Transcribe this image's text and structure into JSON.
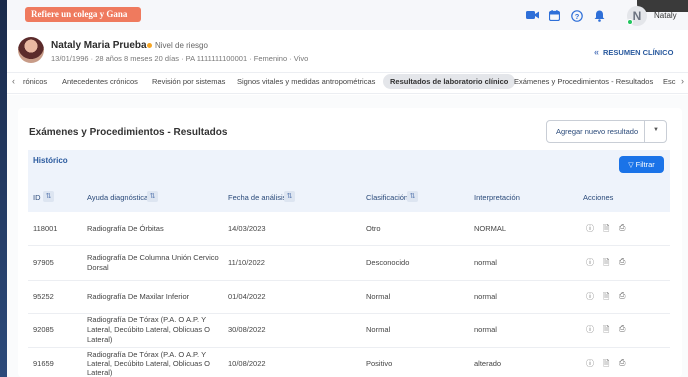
{
  "topbar": {
    "refer_label": "Refiere un colega y Gana",
    "icons": [
      "video-icon",
      "calendar-icon",
      "help-icon",
      "bell-icon"
    ],
    "user_initial": "N",
    "user_name": "Nataly"
  },
  "patient": {
    "name": "Nataly Maria Prueba",
    "risk_label": "Nivel de riesgo",
    "meta": "13/01/1996 · 28 años 8 meses 20 días · PA 1111111100001 · Femenino · Vivo",
    "summary_label": "RESUMEN CLÍNICO"
  },
  "tabs": [
    "rónicos",
    "Antecedentes crónicos",
    "Revisión por sistemas",
    "Signos vitales y medidas antropométricas",
    "Resultados de laboratorio clínico",
    "Exámenes y Procedimientos - Resultados",
    "Esc"
  ],
  "active_tab": "Resultados de laboratorio clínico",
  "main": {
    "title": "Exámenes y Procedimientos - Resultados",
    "add_button": "Agregar nuevo resultado",
    "history_title": "Histórico",
    "filter_label": "Filtrar"
  },
  "table": {
    "headers": [
      "ID",
      "Ayuda diagnóstica",
      "Fecha de análisis",
      "Clasificación",
      "Interpretación",
      "Acciones"
    ],
    "rows": [
      {
        "id": "118001",
        "ayuda": [
          "Radiografía De Órbitas"
        ],
        "fecha": "14/03/2023",
        "clasificacion": "Otro",
        "interpretacion": "NORMAL"
      },
      {
        "id": "97905",
        "ayuda": [
          "Radiografía De Columna Unión Cervico",
          "Dorsal"
        ],
        "fecha": "11/10/2022",
        "clasificacion": "Desconocido",
        "interpretacion": "normal"
      },
      {
        "id": "95252",
        "ayuda": [
          "Radiografía De Maxilar Inferior"
        ],
        "fecha": "01/04/2022",
        "clasificacion": "Normal",
        "interpretacion": "normal"
      },
      {
        "id": "92085",
        "ayuda": [
          "Radiografía De Tórax (P.A. O A.P. Y",
          "Lateral, Decúbito Lateral, Oblicuas O",
          "Lateral)"
        ],
        "fecha": "30/08/2022",
        "clasificacion": "Normal",
        "interpretacion": "normal"
      },
      {
        "id": "91659",
        "ayuda": [
          "Radiografía De Tórax (P.A. O A.P. Y",
          "Lateral, Decúbito Lateral, Oblicuas O",
          "Lateral)"
        ],
        "fecha": "10/08/2022",
        "clasificacion": "Positivo",
        "interpretacion": "alterado"
      }
    ],
    "row_actions": [
      "info-icon",
      "document-icon",
      "print-icon"
    ]
  },
  "colors": {
    "refer_button": "#ef7a5e",
    "accent_blue": "#1a73e8",
    "header_band": "#eef3fb",
    "risk_dot": "#f5a524",
    "online_dot": "#22c55e"
  }
}
